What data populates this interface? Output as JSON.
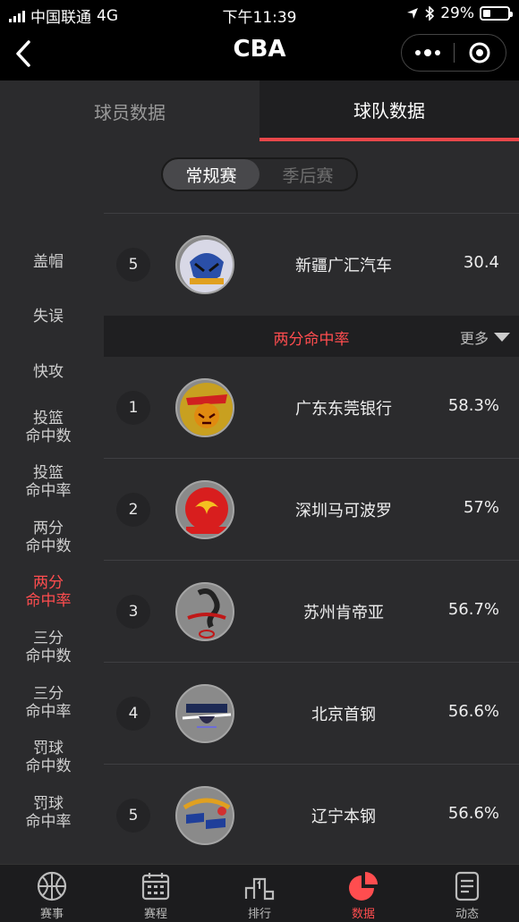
{
  "status": {
    "carrier": "中国联通",
    "network": "4G",
    "time": "下午11:39",
    "battery": "29%",
    "battery_level": 0.29
  },
  "nav": {
    "title": "CBA"
  },
  "tabs": [
    {
      "label": "球员数据"
    },
    {
      "label": "球队数据"
    }
  ],
  "season": {
    "regular": "常规赛",
    "playoffs": "季后赛"
  },
  "sidebar": {
    "items": [
      {
        "label": "盖帽"
      },
      {
        "label": "失误"
      },
      {
        "label": "快攻"
      },
      {
        "label": "投篮\n命中数"
      },
      {
        "label": "投篮\n命中率"
      },
      {
        "label": "两分\n命中数"
      },
      {
        "label": "两分\n命中率"
      },
      {
        "label": "三分\n命中数"
      },
      {
        "label": "三分\n命中率"
      },
      {
        "label": "罚球\n命中数"
      },
      {
        "label": "罚球\n命中率"
      }
    ]
  },
  "prev_row": {
    "rank": "5",
    "team": "新疆广汇汽车",
    "value": "30.4"
  },
  "section": {
    "title": "两分命中率",
    "more": "更多"
  },
  "rows": [
    {
      "rank": "1",
      "team": "广东东莞银行",
      "value": "58.3%"
    },
    {
      "rank": "2",
      "team": "深圳马可波罗",
      "value": "57%"
    },
    {
      "rank": "3",
      "team": "苏州肯帝亚",
      "value": "56.7%"
    },
    {
      "rank": "4",
      "team": "北京首钢",
      "value": "56.6%"
    },
    {
      "rank": "5",
      "team": "辽宁本钢",
      "value": "56.6%"
    }
  ],
  "tabbar": [
    {
      "label": "赛事"
    },
    {
      "label": "赛程"
    },
    {
      "label": "排行"
    },
    {
      "label": "数据"
    },
    {
      "label": "动态"
    }
  ],
  "colors": {
    "accent": "#ff4d4f",
    "background": "#2b2b2d"
  }
}
